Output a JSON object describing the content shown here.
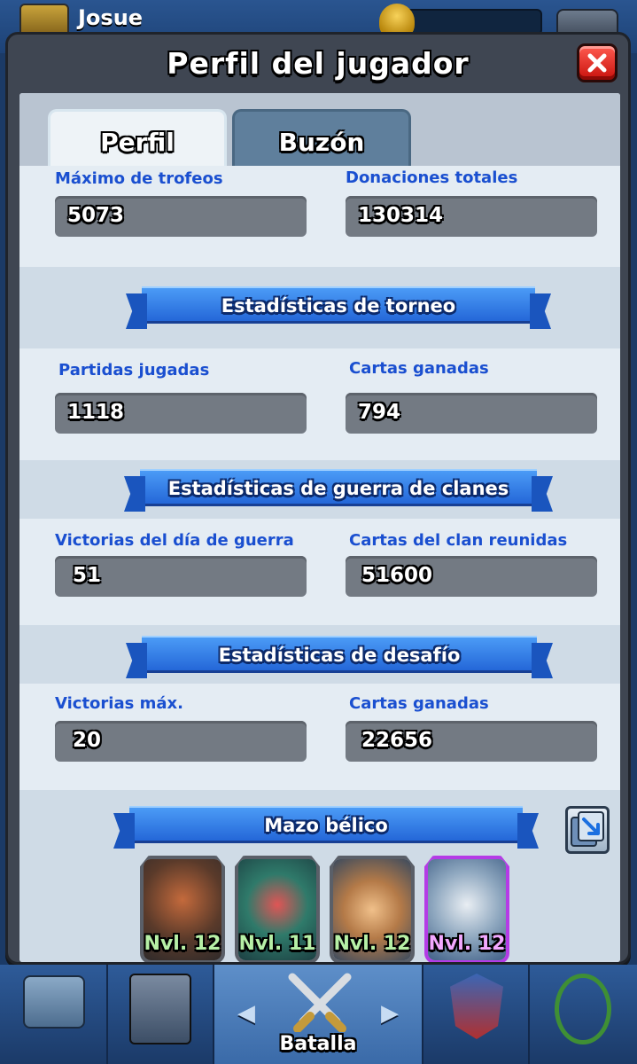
{
  "background": {
    "player_name": "Josue"
  },
  "modal": {
    "title": "Perfil del jugador",
    "close_icon": "close-icon"
  },
  "tabs": [
    {
      "label": "Perfil",
      "active": true
    },
    {
      "label": "Buzón",
      "active": false
    }
  ],
  "profile_stats": {
    "max_trophies": {
      "label": "Máximo de trofeos",
      "value": "5073"
    },
    "total_donations": {
      "label": "Donaciones totales",
      "value": "130314"
    }
  },
  "tournament": {
    "title": "Estadísticas de torneo",
    "games_played": {
      "label": "Partidas jugadas",
      "value": "1118"
    },
    "cards_won": {
      "label": "Cartas ganadas",
      "value": "794"
    }
  },
  "clan_war": {
    "title": "Estadísticas de guerra de clanes",
    "war_day_wins": {
      "label": "Victorias del día de guerra",
      "value": "51"
    },
    "clan_cards_collected": {
      "label": "Cartas del clan reunidas",
      "value": "51600"
    }
  },
  "challenge": {
    "title": "Estadísticas de desafío",
    "max_wins": {
      "label": "Victorias máx.",
      "value": "20"
    },
    "cards_won": {
      "label": "Cartas ganadas",
      "value": "22656"
    }
  },
  "war_deck": {
    "title": "Mazo bélico",
    "copy_icon": "copy-deck-icon",
    "cards": [
      {
        "level": "Nvl. 12",
        "rarity": "common",
        "art": "lava-hound"
      },
      {
        "level": "Nvl. 11",
        "rarity": "common",
        "art": "inferno-dragon"
      },
      {
        "level": "Nvl. 12",
        "rarity": "common",
        "art": "miner"
      },
      {
        "level": "Nvl. 12",
        "rarity": "epic",
        "art": "tornado"
      }
    ]
  },
  "bottom_nav": {
    "battle_label": "Batalla",
    "colors": {
      "accent": "#1a4fd0",
      "close": "#e0261f",
      "ribbon": "#2f7ae6"
    }
  }
}
